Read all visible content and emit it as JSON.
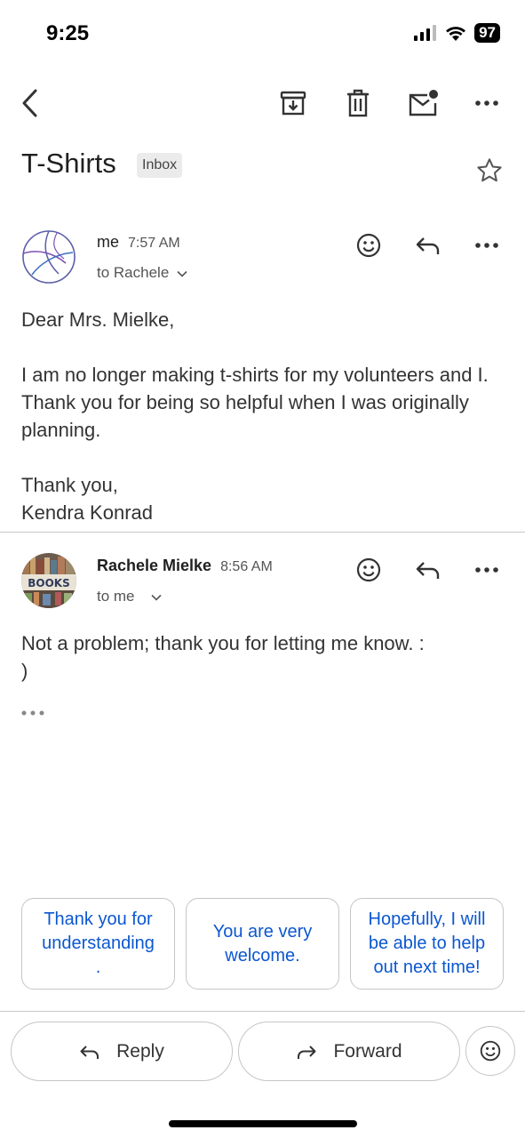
{
  "status_bar": {
    "time": "9:25",
    "battery": "97"
  },
  "toolbar": {
    "back_icon": "chevron-left-icon",
    "archive_icon": "archive-icon",
    "delete_icon": "trash-icon",
    "mark_unread_icon": "mail-unread-icon",
    "more_icon": "more-horizontal-icon"
  },
  "thread": {
    "subject": "T-Shirts",
    "label": "Inbox"
  },
  "messages": [
    {
      "sender": "me",
      "time": "7:57 AM",
      "recipient": "to Rachele",
      "body": [
        "Dear Mrs. Mielke,",
        "I am no longer making t-shirts for my volunteers and I. Thank you for being so helpful when I was originally planning.",
        "Thank you,",
        "Kendra Konrad"
      ]
    },
    {
      "sender": "Rachele Mielke",
      "time": "8:56 AM",
      "recipient": "to me",
      "body": [
        "Not a problem; thank you for letting me know.  :\n)"
      ],
      "avatar_text": "BOOKS"
    }
  ],
  "smart_replies": [
    "Thank you for understanding\n.",
    "You are very welcome.",
    "Hopefully, I will be able to help out next time!"
  ],
  "actions": {
    "reply": "Reply",
    "forward": "Forward"
  },
  "colors": {
    "accent": "#0b57d0",
    "border": "#c4c7c5"
  }
}
